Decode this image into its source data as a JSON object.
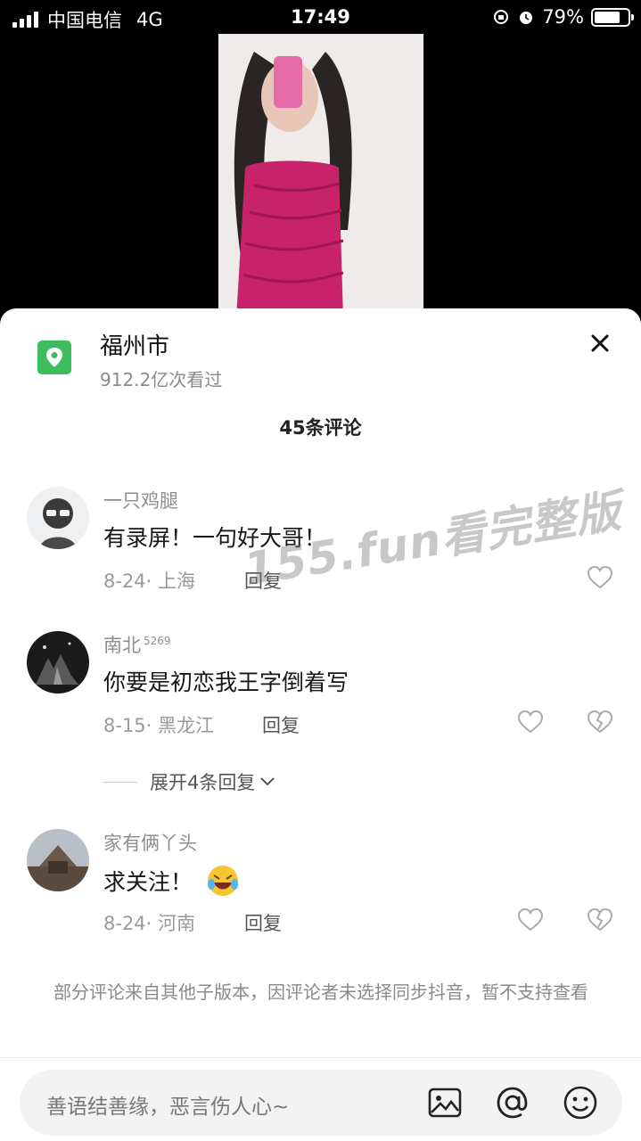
{
  "status_bar": {
    "carrier": "中国电信",
    "network": "4G",
    "time": "17:49",
    "battery": "79%",
    "battery_level": 0.79
  },
  "location": {
    "name": "福州市",
    "views": "912.2亿次看过",
    "icon": "location-pin-icon"
  },
  "comments_header": "45条评论",
  "comments": [
    {
      "user": "一只鸡腿",
      "badge": "",
      "text": "有录屏！一句好大哥！",
      "date": "8-24",
      "region": "上海",
      "reply_label": "回复",
      "emoji": ""
    },
    {
      "user": "南北",
      "badge": "5269",
      "text": "你要是初恋我王字倒着写",
      "date": "8-15",
      "region": "黑龙江",
      "reply_label": "回复",
      "emoji": ""
    },
    {
      "user": "家有俩丫头",
      "badge": "",
      "text": "求关注！",
      "date": "8-24",
      "region": "河南",
      "reply_label": "回复",
      "emoji": "rolling-laugh-emoji"
    }
  ],
  "expand_replies": "展开4条回复",
  "notice": "部分评论来自其他子版本，因评论者未选择同步抖音，暂不支持查看",
  "input": {
    "placeholder": "善语结善缘，恶言伤人心~"
  },
  "watermark": "155.fun看完整版",
  "colors": {
    "accent_green": "#3dbd5d",
    "sheet_bg": "#ffffff",
    "input_bg": "#f3f3f4"
  }
}
